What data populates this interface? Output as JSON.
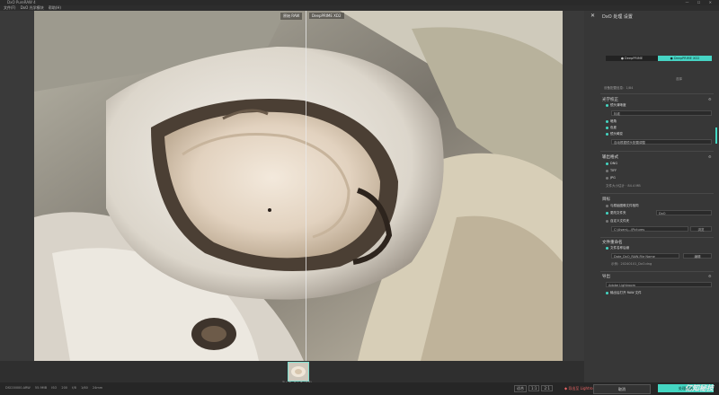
{
  "window": {
    "title": "DxO PureRAW 4",
    "controls": "— ☐ ✕"
  },
  "menu": [
    "文件(F)",
    "DxO 光学模块",
    "帮助(H)"
  ],
  "compare": {
    "left": "原始 RAW",
    "right": "DeepPRIME XD2"
  },
  "filmstrip": {
    "count": "第 1 张，共 1 张（已选）"
  },
  "status": {
    "info": [
      "DSC00000.ARW",
      "55.9MB",
      "ISO 200",
      "f/8",
      "1/60",
      "24mm"
    ],
    "zoom": [
      "适合",
      "1:1",
      "2:1"
    ],
    "export_label": "◆ 导出至 Lightroom",
    "cancel": "取消",
    "save": "处理图像"
  },
  "panel": {
    "title": "DxO 处理 设置",
    "modes": [
      "● DeepPRIME",
      "● DeepPRIME XD2"
    ],
    "preset_label": "选择",
    "model_note": "设备配置信息：1/84",
    "optics": {
      "heading": "光学校正",
      "items": [
        {
          "label": "镜头清晰度",
          "on": true
        },
        {
          "label": "暗角",
          "on": true
        },
        {
          "label": "色差",
          "on": true
        },
        {
          "label": "镜头畸变",
          "on": true
        }
      ],
      "dropdown1": "标准",
      "dropdown2": "自动根据镜头配置调整"
    },
    "output": {
      "heading": "输出格式",
      "items": [
        {
          "label": "DNG",
          "on": true
        },
        {
          "label": "TIFF",
          "on": false
        },
        {
          "label": "JPG",
          "on": false
        }
      ],
      "note": "文件大小估计 · 84.4 MB"
    },
    "destination": {
      "heading": "目标",
      "item1": "与原始图像文件相同",
      "item2": "更改文件夹",
      "field1": "DxO",
      "item3": "自定义文件夹",
      "field2": "C:\\Users\\...\\Pictures",
      "browse": "浏览"
    },
    "rename": {
      "heading": "文件重命名",
      "item": "文件名称后缀",
      "field": "Date_DxO_RAW-File Name",
      "edit": "编辑",
      "note": "示例：20240101_DxO.dng"
    },
    "open_with": {
      "heading": "导出",
      "field": "Adobe Lightroom",
      "item": "输出后打开 RAW 文件"
    }
  },
  "watermark": "亿知秘技"
}
